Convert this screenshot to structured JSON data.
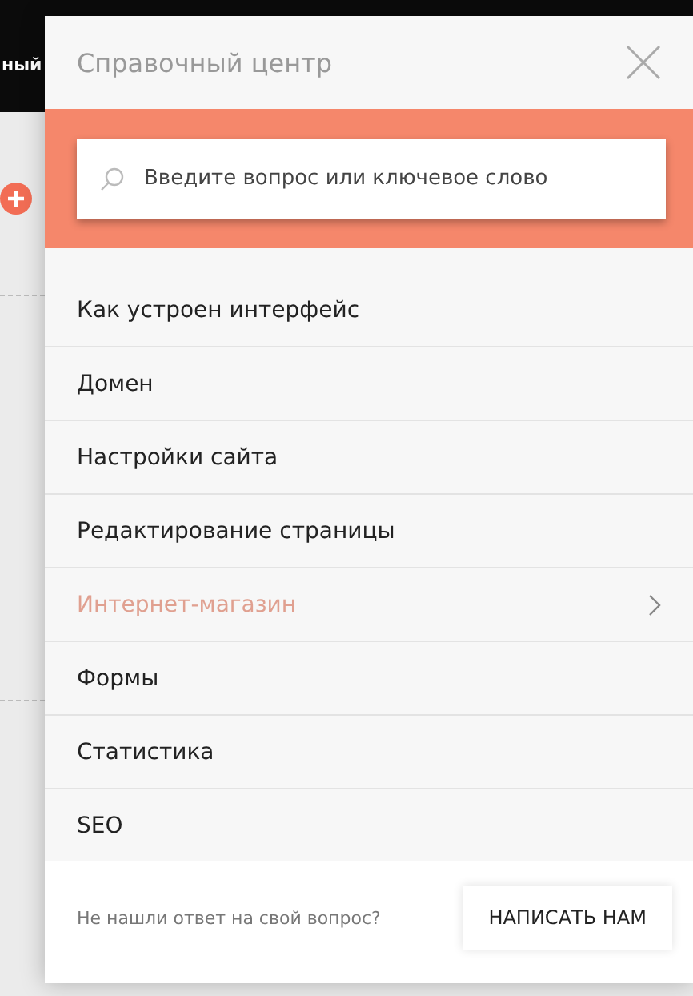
{
  "background": {
    "header_text": "ный"
  },
  "help_center": {
    "title": "Справочный центр",
    "search": {
      "placeholder": "Введите вопрос или ключевое слово"
    },
    "items": [
      {
        "label": "Как устроен интерфейс",
        "selected": false,
        "expandable": false
      },
      {
        "label": "Домен",
        "selected": false,
        "expandable": false
      },
      {
        "label": "Настройки сайта",
        "selected": false,
        "expandable": false
      },
      {
        "label": "Редактирование страницы",
        "selected": false,
        "expandable": false
      },
      {
        "label": "Интернет-магазин",
        "selected": true,
        "expandable": true
      },
      {
        "label": "Формы",
        "selected": false,
        "expandable": false
      },
      {
        "label": "Статистика",
        "selected": false,
        "expandable": false
      },
      {
        "label": "SEO",
        "selected": false,
        "expandable": false
      }
    ],
    "footer": {
      "question": "Не нашли ответ на свой вопрос?",
      "button": "НАПИСАТЬ НАМ"
    }
  }
}
